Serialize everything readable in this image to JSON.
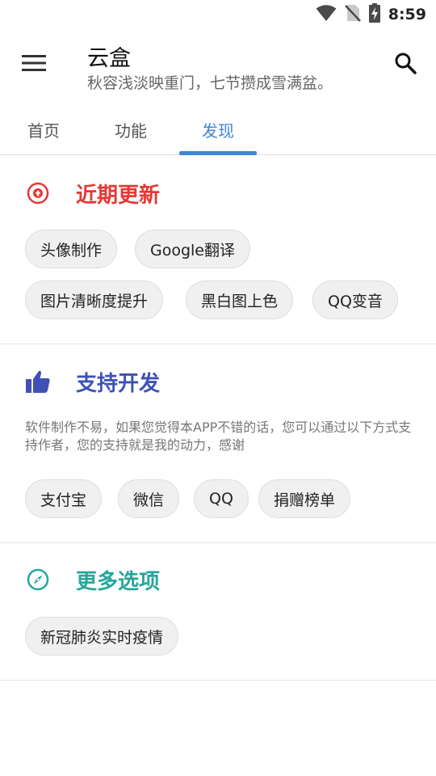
{
  "status_bar": {
    "time": "8:59",
    "icons": [
      "wifi-icon",
      "no-sim-icon",
      "battery-charging-icon"
    ]
  },
  "app_bar": {
    "menu_icon": "menu-icon",
    "title": "云盒",
    "subtitle": "秋容浅淡映重门，七节攒成雪满盆。",
    "search_icon": "search-icon"
  },
  "tabs": [
    {
      "label": "首页",
      "active": false
    },
    {
      "label": "功能",
      "active": false
    },
    {
      "label": "发现",
      "active": true
    }
  ],
  "sections": {
    "recent": {
      "icon": "upload-circle-icon",
      "title": "近期更新",
      "color": "#e53935",
      "chips": [
        "头像制作",
        "Google翻译",
        "图片清晰度提升",
        "黑白图上色",
        "QQ变音"
      ]
    },
    "support": {
      "icon": "thumbs-up-icon",
      "title": "支持开发",
      "color": "#3f51b5",
      "description": "软件制作不易，如果您觉得本APP不错的话，您可以通过以下方式支持作者，您的支持就是我的动力，感谢",
      "chips": [
        "支付宝",
        "微信",
        "QQ",
        "捐赠榜单"
      ]
    },
    "more": {
      "icon": "compass-icon",
      "title": "更多选项",
      "color": "#26a69a",
      "chips": [
        "新冠肺炎实时疫情"
      ]
    }
  },
  "colors": {
    "accent": "#3f86d6",
    "chip_bg": "#f0f0f0"
  }
}
